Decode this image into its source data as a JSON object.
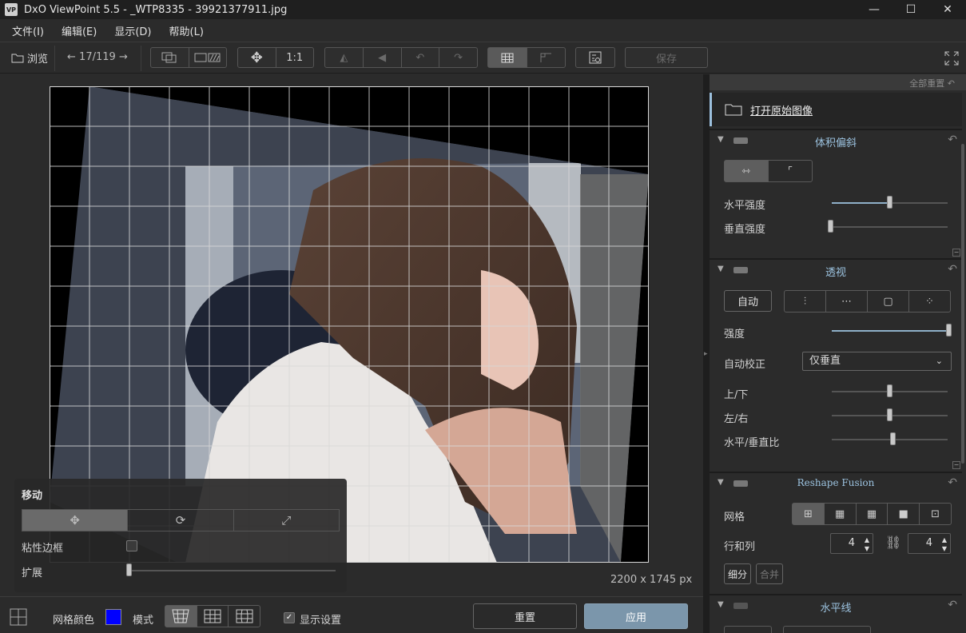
{
  "window": {
    "title": "DxO ViewPoint 5.5 - _WTP8335 - 39921377911.jpg",
    "logo": "VP",
    "minimize": "—",
    "maximize": "☐",
    "close": "✕"
  },
  "menu": [
    "文件(I)",
    "编辑(E)",
    "显示(D)",
    "帮助(L)"
  ],
  "toolbar": {
    "browse": "浏览",
    "counter": "17/119",
    "one_to_one": "1:1",
    "save": "保存"
  },
  "canvas": {
    "dimensions": "2200 x 1745 px"
  },
  "move_panel": {
    "title": "移动",
    "sticky_border": "粘性边框",
    "expand": "扩展"
  },
  "bottom": {
    "grid_color_label": "网格颜色",
    "grid_color": "#0000ff",
    "mode_label": "模式",
    "show_settings": "显示设置",
    "reset": "重置",
    "apply": "应用"
  },
  "right_panel": {
    "reset_all": "全部重置",
    "open_original": "打开原始图像",
    "volume": {
      "title": "体积偏斜",
      "horizontal": "水平强度",
      "vertical": "垂直强度",
      "horizontal_value": 0.5,
      "vertical_value": 0.0
    },
    "perspective": {
      "title": "透视",
      "auto": "自动",
      "strength": "强度",
      "strength_value": 1.0,
      "auto_correct": "自动校正",
      "auto_correct_value": "仅垂直",
      "up_down": "上/下",
      "left_right": "左/右",
      "hv_ratio": "水平/垂直比",
      "up_down_value": 0.5,
      "left_right_value": 0.5,
      "hv_ratio_value": 0.52
    },
    "reshape": {
      "title": "Reshape Fusion",
      "grid": "网格",
      "rows_cols": "行和列",
      "rows": "4",
      "cols": "4",
      "subdivide": "细分",
      "merge": "合并"
    },
    "horizon": {
      "title": "水平线"
    }
  },
  "colors": {
    "accent": "#9cc3e0",
    "apply_button": "#7b96ab"
  }
}
